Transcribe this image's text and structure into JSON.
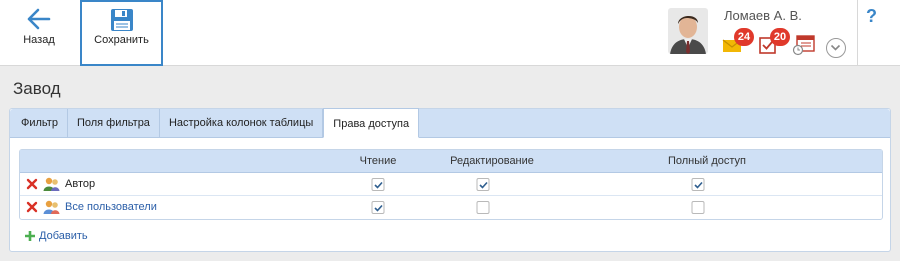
{
  "toolbar": {
    "back_label": "Назад",
    "save_label": "Сохранить",
    "accent": "#3a86c8"
  },
  "user": {
    "name": "Ломаев А. В.",
    "mail_count": "24",
    "tasks_count": "20"
  },
  "help_label": "?",
  "page": {
    "title": "Завод"
  },
  "tabs": [
    {
      "label": "Фильтр",
      "active": false
    },
    {
      "label": "Поля фильтра",
      "active": false
    },
    {
      "label": "Настройка колонок таблицы",
      "active": false
    },
    {
      "label": "Права доступа",
      "active": true
    }
  ],
  "grid": {
    "columns": [
      "Чтение",
      "Редактирование",
      "Полный доступ"
    ],
    "rows": [
      {
        "name": "Автор",
        "icon": "user-group-icon",
        "read": true,
        "edit": true,
        "full": true
      },
      {
        "name": "Все пользователи",
        "icon": "users-icon",
        "read": true,
        "edit": false,
        "full": false
      }
    ]
  },
  "add_label": "Добавить",
  "colors": {
    "tab_bg": "#cfe0f5",
    "badge": "#e0392b",
    "link": "#2a5ea8",
    "delete": "#d93025",
    "add": "#4caf50"
  }
}
